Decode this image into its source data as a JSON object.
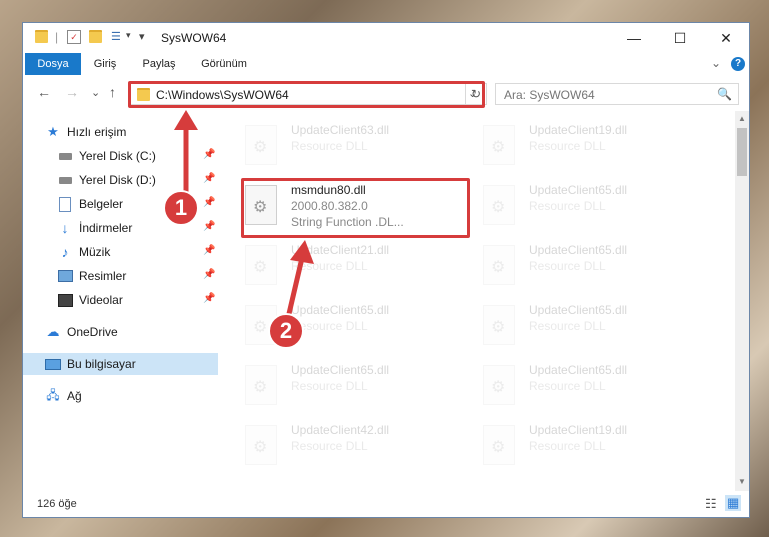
{
  "window": {
    "title": "SysWOW64",
    "minimize_glyph": "—",
    "maximize_glyph": "☐",
    "close_glyph": "✕",
    "qa_pin_glyph": "|",
    "qa_dropdown_glyph": "▾",
    "qa_separator": "|"
  },
  "ribbon": {
    "tabs": [
      "Dosya",
      "Giriş",
      "Paylaş",
      "Görünüm"
    ],
    "active_tab": "Dosya",
    "expand_glyph": "⌄",
    "help_glyph": "?"
  },
  "nav": {
    "back_glyph": "←",
    "forward_glyph": "→",
    "recent_glyph": "⌄",
    "up_glyph": "↑",
    "address": "C:\\Windows\\SysWOW64",
    "address_dropdown_glyph": "⌄",
    "refresh_glyph": "↻",
    "search_placeholder": "Ara: SysWOW64",
    "search_glyph": "🔍"
  },
  "sidebar": {
    "items": [
      {
        "label": "Hızlı erişim",
        "icon": "star-icon"
      },
      {
        "label": "Yerel Disk (C:)",
        "icon": "drive-icon",
        "pinned": true
      },
      {
        "label": "Yerel Disk (D:)",
        "icon": "drive-icon",
        "pinned": true
      },
      {
        "label": "Belgeler",
        "icon": "documents-icon",
        "pinned": true
      },
      {
        "label": "İndirmeler",
        "icon": "download-icon",
        "pinned": true
      },
      {
        "label": "Müzik",
        "icon": "music-icon",
        "pinned": true
      },
      {
        "label": "Resimler",
        "icon": "pictures-icon",
        "pinned": true
      },
      {
        "label": "Videolar",
        "icon": "video-icon",
        "pinned": true
      },
      {
        "label": "OneDrive",
        "icon": "cloud-icon"
      },
      {
        "label": "Bu bilgisayar",
        "icon": "computer-icon",
        "selected": true
      },
      {
        "label": "Ağ",
        "icon": "network-icon"
      }
    ],
    "pin_glyph": "📌"
  },
  "files": {
    "left": [
      {
        "name": "UpdateClient63.dll",
        "type": "Resource DLL"
      },
      {
        "name": "msmdun80.dll",
        "version": "2000.80.382.0",
        "desc": "String Function .DL..."
      },
      {
        "name": "UpdateClient21.dll",
        "type": "Resource DLL"
      },
      {
        "name": "UpdateClient65.dll",
        "type": "Resource DLL"
      },
      {
        "name": "UpdateClient65.dll",
        "type": "Resource DLL"
      },
      {
        "name": "UpdateClient42.dll",
        "type": "Resource DLL"
      }
    ],
    "right": [
      {
        "name": "UpdateClient19.dll",
        "type": "Resource DLL"
      },
      {
        "name": "UpdateClient65.dll",
        "type": "Resource DLL"
      },
      {
        "name": "UpdateClient65.dll",
        "type": "Resource DLL"
      },
      {
        "name": "UpdateClient65.dll",
        "type": "Resource DLL"
      },
      {
        "name": "UpdateClient65.dll",
        "type": "Resource DLL"
      },
      {
        "name": "UpdateClient19.dll",
        "type": "Resource DLL"
      }
    ]
  },
  "status": {
    "item_count": "126 öğe",
    "details_view_glyph": "☷",
    "tiles_view_glyph": "▦"
  },
  "annotations": {
    "step1": "1",
    "step2": "2",
    "color": "#d63c3c"
  },
  "colors": {
    "accent": "#1979ca",
    "selection": "#cce4f7"
  }
}
